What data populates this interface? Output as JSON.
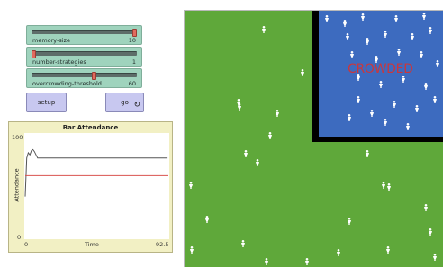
{
  "sliders": [
    {
      "label": "memory-size",
      "value": "10",
      "fraction": 1.0
    },
    {
      "label": "number-strategies",
      "value": "1",
      "fraction": 0.0
    },
    {
      "label": "overcrowding-threshold",
      "value": "60",
      "fraction": 0.6
    }
  ],
  "buttons": {
    "setup": "setup",
    "go": "go",
    "go_icon": "forever-loop-icon"
  },
  "plot": {
    "title": "Bar Attendance",
    "ylabel": "Attendance",
    "xlabel": "Time",
    "ymax_label": "100",
    "ymin_label": "0",
    "xmin_label": "0",
    "xmax_label": "92.5"
  },
  "world": {
    "overlay_text": "CROWDED"
  },
  "colors": {
    "patch_green": "#5fa83a",
    "bar_blue": "#3d6bbf",
    "bar_border": "#000000",
    "crowded_red": "#c9373d",
    "person_white": "#ffffff",
    "attendance_line": "#555555",
    "threshold_line": "#d9534f"
  },
  "chart_data": {
    "type": "line",
    "title": "Bar Attendance",
    "xlabel": "Time",
    "ylabel": "Attendance",
    "xlim": [
      0,
      92.5
    ],
    "ylim": [
      0,
      100
    ],
    "series": [
      {
        "x": [
          0,
          1,
          2,
          3,
          4,
          5,
          6,
          7,
          8,
          9,
          10,
          15,
          20,
          40,
          60,
          80,
          92
        ],
        "y": [
          40,
          77,
          82,
          80,
          84,
          85,
          83,
          80,
          77,
          77,
          77,
          77,
          77,
          77,
          77,
          77,
          77
        ]
      },
      {
        "x": [
          0,
          92.5
        ],
        "y": [
          60,
          60
        ]
      }
    ]
  }
}
